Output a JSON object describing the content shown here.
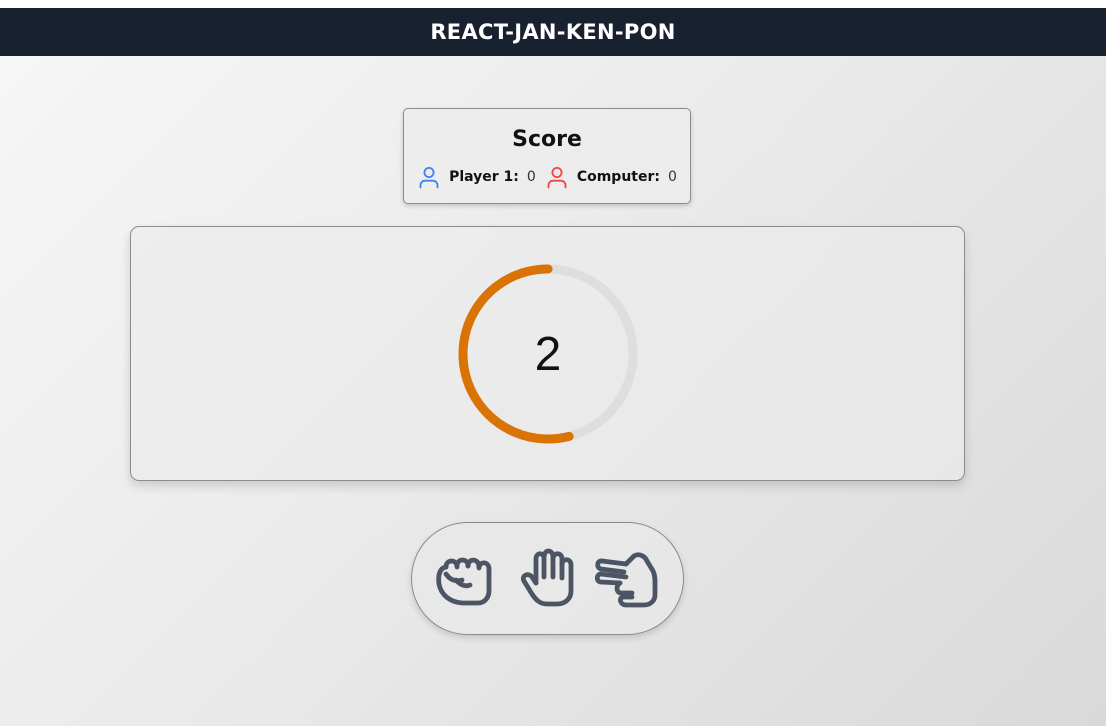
{
  "header": {
    "title": "REACT-JAN-KEN-PON"
  },
  "score": {
    "title": "Score",
    "player": {
      "label": "Player 1:",
      "value": "0",
      "icon": "user-icon",
      "color": "#3b82f6"
    },
    "computer": {
      "label": "Computer:",
      "value": "0",
      "icon": "user-icon",
      "color": "#ef4444"
    }
  },
  "countdown": {
    "value": "2",
    "progress": 0.54,
    "accent_color": "#d97304",
    "track_color": "#dedede"
  },
  "choices": [
    {
      "name": "rock",
      "icon": "fist-icon"
    },
    {
      "name": "paper",
      "icon": "open-hand-icon"
    },
    {
      "name": "scissors",
      "icon": "scissors-hand-icon"
    }
  ],
  "colors": {
    "header_bg": "#18212f",
    "icon_gray": "#4b5563"
  }
}
